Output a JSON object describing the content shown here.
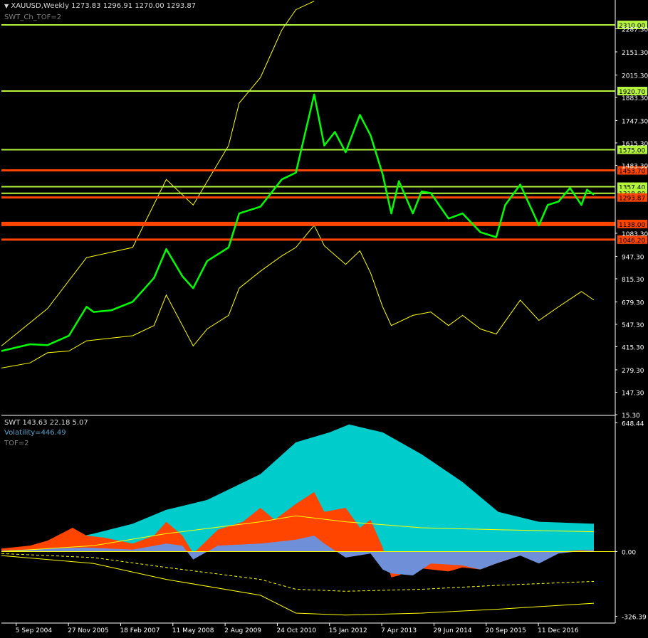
{
  "header": {
    "symbol_line": "XAUUSD,Weekly  1273.83 1296.91 1270.00 1293.87",
    "indicator_label": "SWT_Ch_TOF=2"
  },
  "sub_window": {
    "title_line": "SWT 143.63 22.18 5.07",
    "volatility_label": "Volatility=446.49",
    "tof_label": "TOF=2"
  },
  "colors": {
    "background": "#000000",
    "price_line": "#00ff00",
    "channel_line": "#ffff00",
    "level_green": "#b5f53c",
    "level_red": "#ff4500",
    "volatility_fill": "#00cccc",
    "trend_fill": "#ff4500",
    "momentum_fill": "#6f8fd8",
    "axis": "#ffffff"
  },
  "chart_data": [
    {
      "type": "line",
      "name": "XAUUSD Weekly",
      "x_tick_labels": [
        "5 Sep 2004",
        "27 Nov 2005",
        "18 Feb 2007",
        "11 May 2008",
        "2 Aug 2009",
        "24 Oct 2010",
        "15 Jan 2012",
        "7 Apr 2013",
        "29 Jun 2014",
        "20 Sep 2015",
        "11 Dec 2016"
      ],
      "x_tick_dates": [
        "2004-09-05",
        "2005-11-27",
        "2007-02-18",
        "2008-05-11",
        "2009-08-02",
        "2010-10-24",
        "2012-01-15",
        "2013-04-07",
        "2014-06-29",
        "2015-09-20",
        "2016-12-11"
      ],
      "xlim": [
        "2004-05-01",
        "2018-10-01"
      ],
      "ylim": [
        15.3,
        2440
      ],
      "y_tick_labels": [
        "2287.30",
        "2151.30",
        "2015.30",
        "1883.30",
        "1747.30",
        "1615.30",
        "1483.30",
        "1083.30",
        "947.30",
        "815.30",
        "679.30",
        "547.30",
        "415.30",
        "279.30",
        "147.30",
        "15.30"
      ],
      "y_ticks": [
        2287.3,
        2151.3,
        2015.3,
        1883.3,
        1747.3,
        1615.3,
        1483.3,
        1083.3,
        947.3,
        815.3,
        679.3,
        547.3,
        415.3,
        279.3,
        147.3,
        15.3
      ],
      "horizontal_levels": [
        {
          "value": 2310.0,
          "label": "2310.00",
          "color": "#b5f53c"
        },
        {
          "value": 1920.7,
          "label": "1920.70",
          "color": "#b5f53c"
        },
        {
          "value": 1575.0,
          "label": "1575.00",
          "color": "#b5f53c"
        },
        {
          "value": 1453.7,
          "label": "1453.70",
          "color": "#ff4500"
        },
        {
          "value": 1357.4,
          "label": "1357.40",
          "color": "#b5f53c"
        },
        {
          "value": 1318.8,
          "label": "1318.80",
          "color": "#b5f53c"
        },
        {
          "value": 1293.87,
          "label": "1293.87",
          "color": "#ff4500"
        },
        {
          "value": 1138.0,
          "label": "1138.00",
          "color": "#ff4500"
        },
        {
          "value": 1046.2,
          "label": "1046.20",
          "color": "#ff4500"
        }
      ],
      "series": [
        {
          "name": "price",
          "role": "price",
          "x": [
            "2004-05-01",
            "2005-01-01",
            "2005-06-01",
            "2005-12-01",
            "2006-05-01",
            "2006-07-01",
            "2006-12-01",
            "2007-06-01",
            "2007-12-01",
            "2008-03-15",
            "2008-08-01",
            "2008-11-01",
            "2009-03-01",
            "2009-09-01",
            "2009-12-01",
            "2010-06-01",
            "2010-12-01",
            "2011-04-01",
            "2011-09-05",
            "2011-12-01",
            "2012-03-01",
            "2012-06-01",
            "2012-10-01",
            "2013-01-01",
            "2013-04-15",
            "2013-06-28",
            "2013-09-01",
            "2013-12-30",
            "2014-03-15",
            "2014-06-01",
            "2014-11-01",
            "2015-03-01",
            "2015-08-01",
            "2015-12-15",
            "2016-03-01",
            "2016-07-08",
            "2016-12-15",
            "2017-03-01",
            "2017-06-01",
            "2017-09-08",
            "2017-12-15",
            "2018-02-01",
            "2018-04-01"
          ],
          "values": [
            390,
            430,
            425,
            480,
            650,
            620,
            630,
            680,
            820,
            990,
            830,
            760,
            920,
            1000,
            1200,
            1240,
            1400,
            1440,
            1900,
            1600,
            1680,
            1560,
            1780,
            1660,
            1430,
            1200,
            1390,
            1200,
            1330,
            1320,
            1170,
            1200,
            1090,
            1060,
            1250,
            1370,
            1130,
            1250,
            1270,
            1350,
            1250,
            1340,
            1310
          ]
        },
        {
          "name": "upper channel",
          "role": "channel",
          "x": [
            "2004-05-01",
            "2005-06-01",
            "2006-05-01",
            "2007-06-01",
            "2008-03-15",
            "2008-11-01",
            "2009-09-01",
            "2009-12-01",
            "2010-06-01",
            "2010-12-01",
            "2011-04-01",
            "2011-09-05"
          ],
          "values": [
            420,
            640,
            940,
            1000,
            1400,
            1250,
            1600,
            1850,
            2000,
            2280,
            2400,
            2450
          ]
        },
        {
          "name": "lower channel",
          "role": "channel",
          "x": [
            "2004-05-01",
            "2005-01-01",
            "2005-06-01",
            "2005-12-01",
            "2006-05-01",
            "2007-06-01",
            "2007-12-01",
            "2008-03-15",
            "2008-08-01",
            "2008-11-01",
            "2009-03-01",
            "2009-09-01",
            "2009-12-01",
            "2010-06-01",
            "2010-12-01",
            "2011-04-01",
            "2011-09-05",
            "2011-12-01",
            "2012-06-01",
            "2012-10-01",
            "2013-01-01",
            "2013-04-15",
            "2013-06-28",
            "2013-12-30",
            "2014-06-01",
            "2014-11-01",
            "2015-03-01",
            "2015-08-01",
            "2015-12-15",
            "2016-07-08",
            "2016-12-15",
            "2017-06-01",
            "2017-12-15",
            "2018-04-01"
          ],
          "values": [
            290,
            320,
            380,
            390,
            450,
            480,
            540,
            720,
            540,
            420,
            520,
            600,
            760,
            860,
            950,
            1000,
            1130,
            1010,
            900,
            980,
            850,
            650,
            540,
            600,
            620,
            540,
            600,
            520,
            490,
            690,
            570,
            650,
            740,
            690
          ]
        }
      ]
    },
    {
      "type": "area",
      "name": "SWT",
      "x_tick_labels": [
        "5 Sep 2004",
        "27 Nov 2005",
        "18 Feb 2007",
        "11 May 2008",
        "2 Aug 2009",
        "24 Oct 2010",
        "15 Jan 2012",
        "7 Apr 2013",
        "29 Jun 2014",
        "20 Sep 2015",
        "11 Dec 2016"
      ],
      "xlim": [
        "2004-05-01",
        "2018-10-01"
      ],
      "ylim": [
        -360,
        675
      ],
      "y_tick_labels": [
        "648.44",
        "0.00",
        "-326.39"
      ],
      "y_ticks": [
        648.44,
        0,
        -326.39
      ],
      "series": [
        {
          "name": "Volatility",
          "role": "fill",
          "color": "#00cccc",
          "x": [
            "2004-05-01",
            "2005-06-01",
            "2006-07-01",
            "2007-06-01",
            "2008-03-15",
            "2009-03-01",
            "2010-06-01",
            "2011-04-01",
            "2012-01-15",
            "2012-07-01",
            "2013-04-15",
            "2014-03-15",
            "2015-03-01",
            "2016-01-01",
            "2016-12-15",
            "2018-04-01"
          ],
          "values": [
            0,
            40,
            90,
            140,
            210,
            260,
            390,
            550,
            600,
            640,
            600,
            490,
            350,
            200,
            150,
            140
          ]
        },
        {
          "name": "Trend",
          "role": "fill",
          "color": "#ff4500",
          "x": [
            "2004-05-01",
            "2005-01-01",
            "2005-06-01",
            "2006-01-01",
            "2006-05-01",
            "2006-10-01",
            "2007-06-01",
            "2007-12-01",
            "2008-03-15",
            "2008-08-01",
            "2008-11-01",
            "2009-06-01",
            "2010-01-01",
            "2010-06-01",
            "2010-10-01",
            "2011-04-01",
            "2011-09-05",
            "2011-12-01",
            "2012-06-01",
            "2012-10-01",
            "2013-01-01",
            "2013-04-15",
            "2013-06-28",
            "2013-09-01",
            "2013-12-30",
            "2014-06-01",
            "2014-11-01",
            "2015-03-01",
            "2015-08-01",
            "2015-12-15",
            "2016-07-08",
            "2016-12-15",
            "2017-06-01",
            "2018-04-01"
          ],
          "values": [
            15,
            30,
            55,
            120,
            80,
            70,
            40,
            80,
            150,
            80,
            -10,
            110,
            150,
            220,
            160,
            240,
            300,
            200,
            220,
            120,
            160,
            20,
            -130,
            -120,
            -80,
            -90,
            -100,
            -80,
            -90,
            -60,
            -20,
            -30,
            0,
            10
          ]
        },
        {
          "name": "Momentum",
          "role": "fill",
          "color": "#6f8fd8",
          "x": [
            "2004-05-01",
            "2005-06-01",
            "2006-05-01",
            "2007-06-01",
            "2008-03-15",
            "2008-08-01",
            "2008-11-01",
            "2009-06-01",
            "2010-06-01",
            "2011-04-01",
            "2011-09-05",
            "2011-12-01",
            "2012-06-01",
            "2013-01-01",
            "2013-04-15",
            "2013-06-28",
            "2013-12-30",
            "2014-06-01",
            "2015-03-01",
            "2015-08-01",
            "2015-12-15",
            "2016-07-08",
            "2016-12-15",
            "2017-06-01",
            "2018-04-01"
          ],
          "values": [
            5,
            15,
            20,
            10,
            40,
            30,
            -40,
            30,
            40,
            60,
            80,
            40,
            -30,
            -10,
            -90,
            -110,
            -120,
            -60,
            -70,
            -90,
            -60,
            -20,
            -60,
            -10,
            10
          ]
        },
        {
          "name": "upper envelope",
          "role": "envelope",
          "x": [
            "2004-05-01",
            "2006-07-01",
            "2008-03-15",
            "2010-06-01",
            "2011-04-01",
            "2012-06-01",
            "2014-03-15",
            "2016-01-01",
            "2018-04-01"
          ],
          "values": [
            0,
            30,
            90,
            150,
            180,
            150,
            120,
            110,
            100
          ]
        },
        {
          "name": "lower envelope",
          "role": "envelope",
          "x": [
            "2004-05-01",
            "2006-07-01",
            "2008-03-15",
            "2010-06-01",
            "2011-04-01",
            "2012-06-01",
            "2014-03-15",
            "2016-01-01",
            "2018-04-01"
          ],
          "values": [
            -20,
            -60,
            -140,
            -220,
            -310,
            -320,
            -310,
            -290,
            -260
          ]
        },
        {
          "name": "signal",
          "role": "envelope",
          "x": [
            "2004-05-01",
            "2006-07-01",
            "2008-03-15",
            "2010-06-01",
            "2011-04-01",
            "2012-06-01",
            "2014-03-15",
            "2016-01-01",
            "2018-04-01"
          ],
          "values": [
            -10,
            -30,
            -80,
            -140,
            -190,
            -200,
            -190,
            -170,
            -150
          ]
        }
      ]
    }
  ]
}
